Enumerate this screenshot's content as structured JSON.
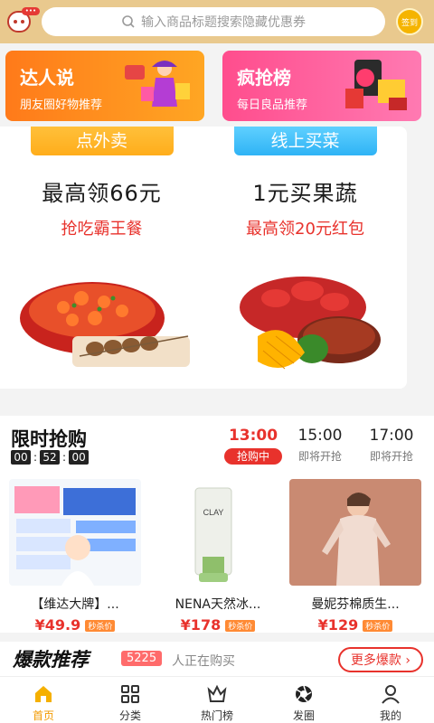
{
  "header": {
    "search_placeholder": "输入商品标题搜索隐藏优惠券",
    "left_badge": "•••",
    "right_badge": "签到"
  },
  "promos": [
    {
      "title": "达人说",
      "subtitle": "朋友圈好物推荐"
    },
    {
      "title": "疯抢榜",
      "subtitle": "每日良品推荐"
    }
  ],
  "food": {
    "left": {
      "tag": "点外卖",
      "main": "最高领66元",
      "sub": "抢吃霸王餐"
    },
    "right": {
      "tag": "线上买菜",
      "main": "1元买果蔬",
      "sub": "最高领20元红包"
    }
  },
  "flash_sale": {
    "title": "限时抢购",
    "countdown": [
      "00",
      "52",
      "00"
    ],
    "slots": [
      {
        "time": "13:00",
        "status": "抢购中"
      },
      {
        "time": "15:00",
        "status": "即将开抢"
      },
      {
        "time": "17:00",
        "status": "即将开抢"
      }
    ],
    "products": [
      {
        "name": "【维达大牌】...",
        "price": "¥49.9",
        "tag": "秒杀价"
      },
      {
        "name": "NENA天然冰...",
        "price": "¥178",
        "tag": "秒杀价"
      },
      {
        "name": "曼妮芬棉质生...",
        "price": "¥129",
        "tag": "秒杀价"
      }
    ]
  },
  "bestseller": {
    "title": "爆款推荐",
    "count": "5225",
    "text": "人正在购买",
    "more": "更多爆款 ›"
  },
  "nav": [
    {
      "label": "首页",
      "icon": "home-icon"
    },
    {
      "label": "分类",
      "icon": "grid-icon"
    },
    {
      "label": "热门榜",
      "icon": "crown-icon"
    },
    {
      "label": "发圈",
      "icon": "aperture-icon"
    },
    {
      "label": "我的",
      "icon": "user-icon"
    }
  ],
  "colors": {
    "accent": "#e8322c",
    "header_bg": "#e9c98e",
    "nav_active": "#f29a00"
  }
}
